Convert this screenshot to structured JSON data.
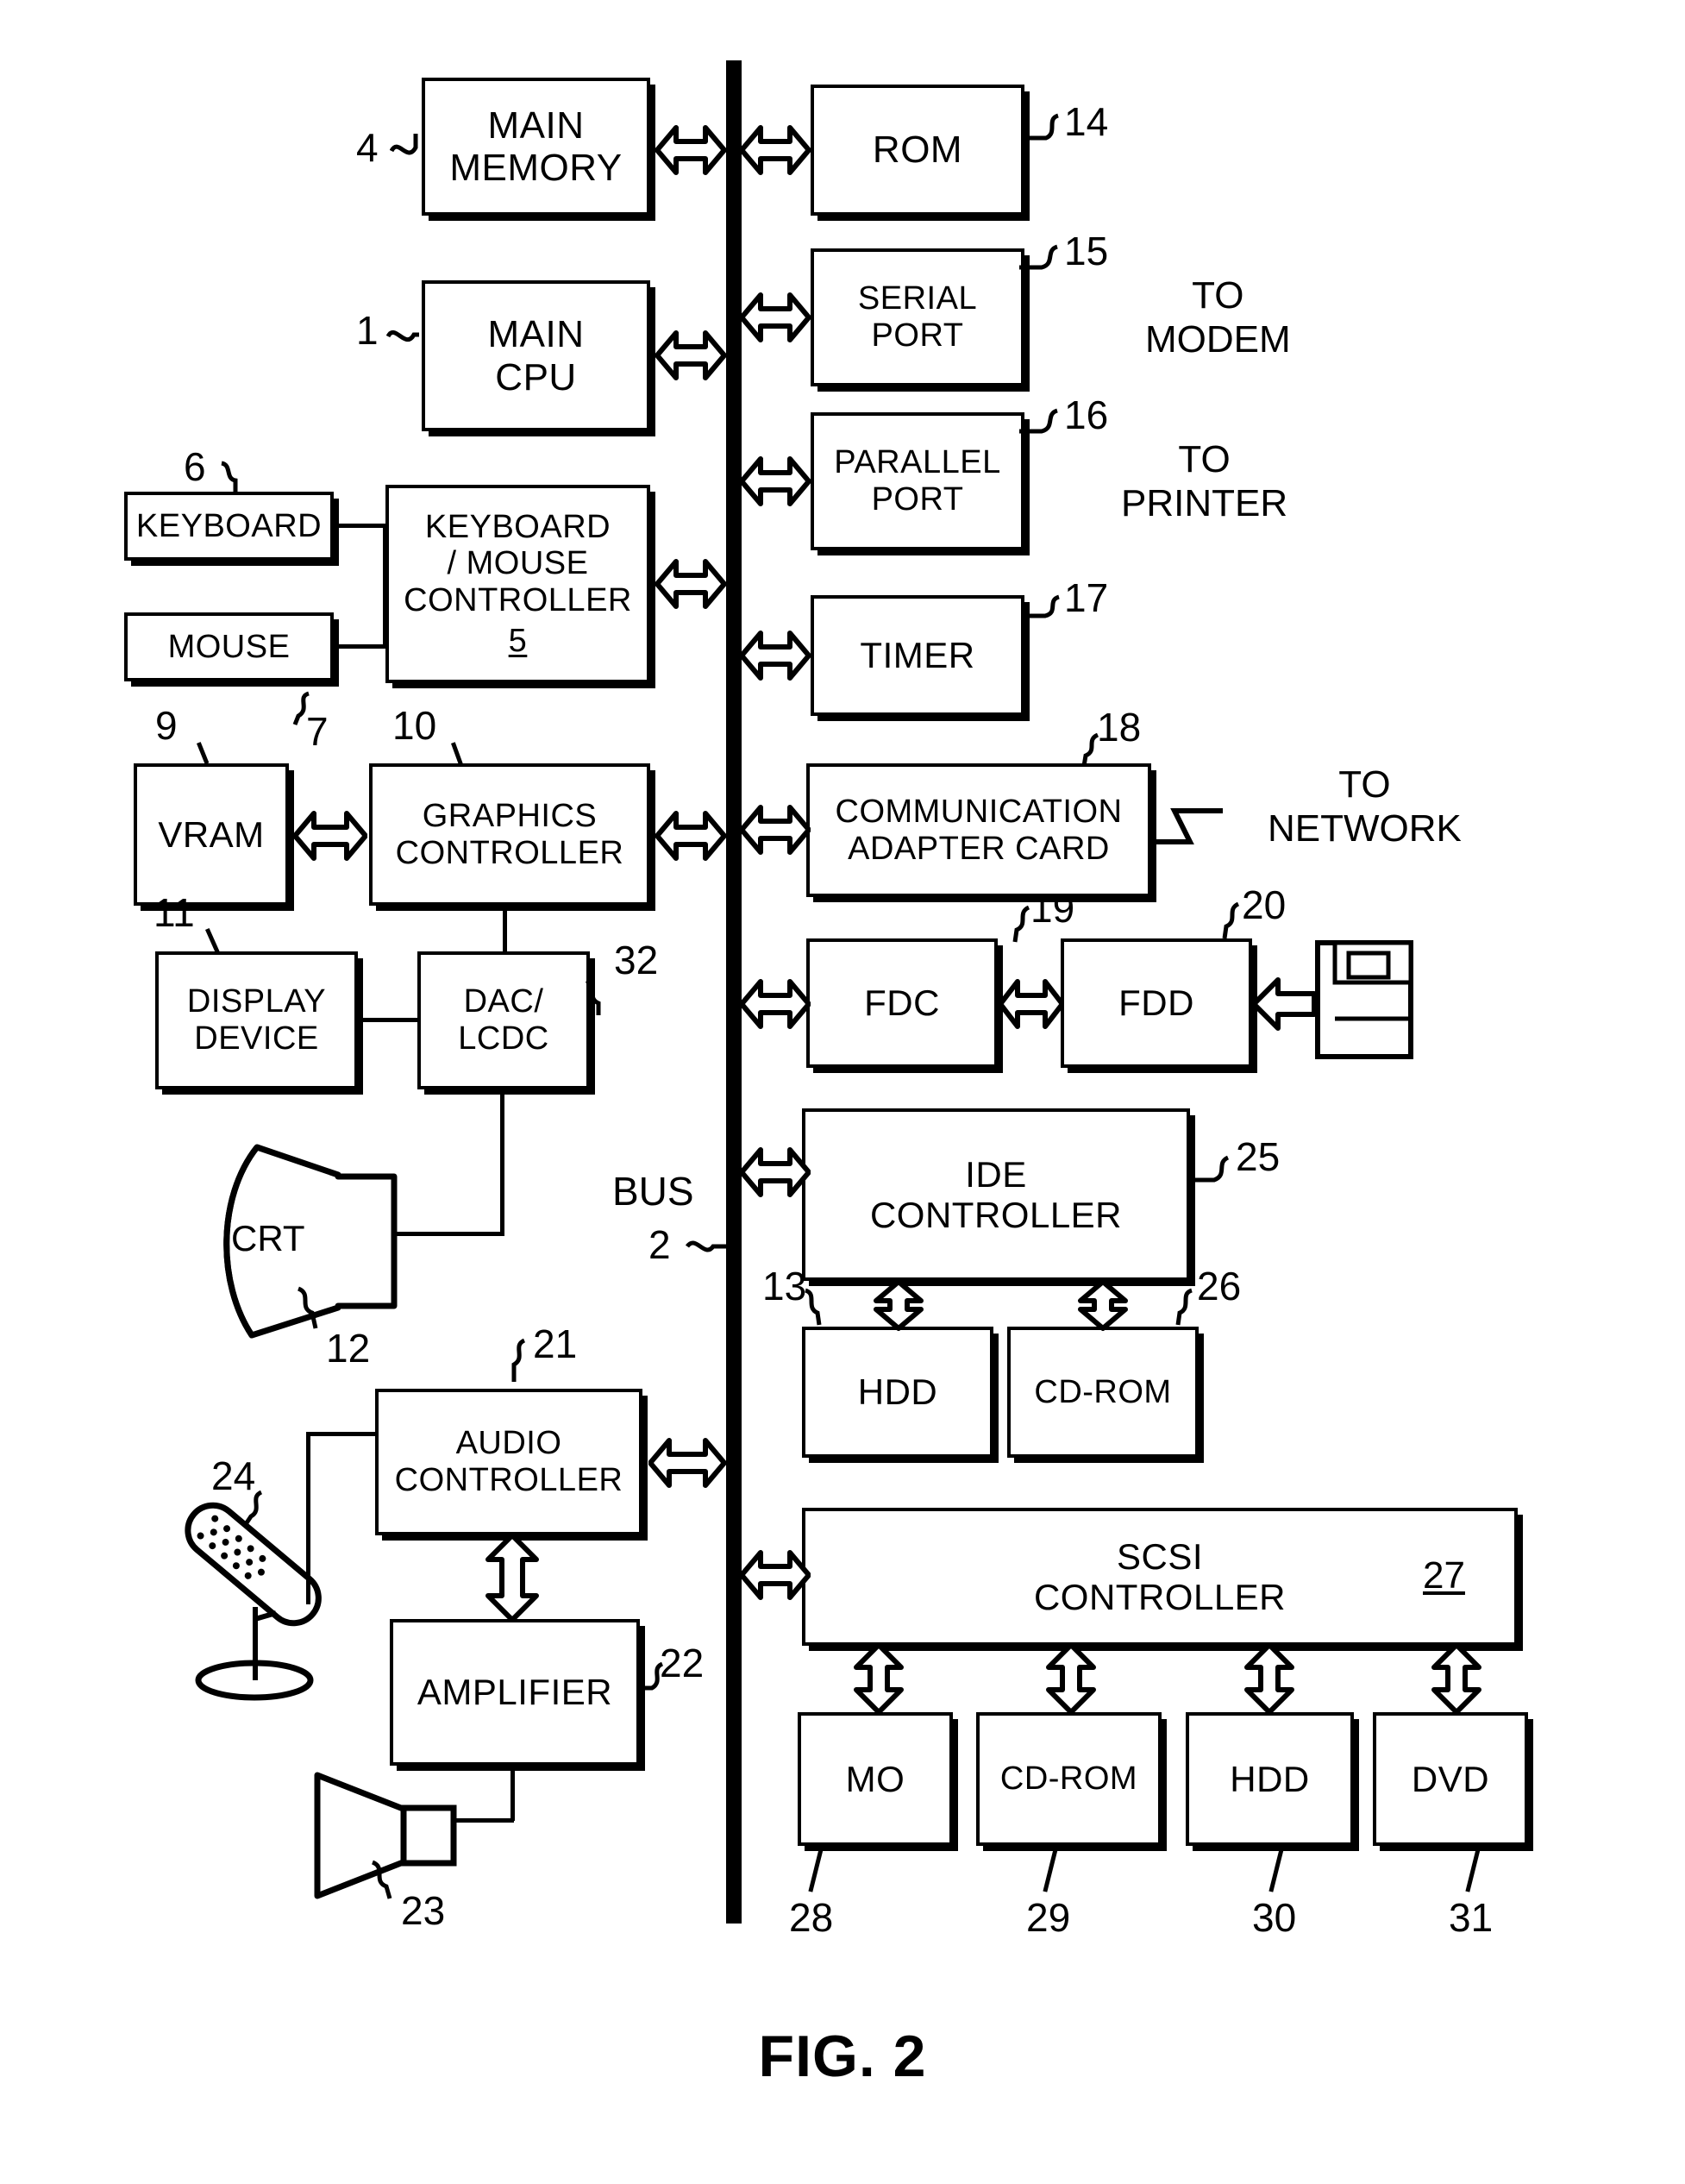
{
  "figure": {
    "caption": "FIG. 2",
    "bus_label": "BUS",
    "bus_ref": "2"
  },
  "blocks": [
    {
      "id": "main-memory",
      "label": "MAIN\nMEMORY",
      "ref": "4"
    },
    {
      "id": "main-cpu",
      "label": "MAIN\nCPU",
      "ref": "1"
    },
    {
      "id": "keyboard",
      "label": "KEYBOARD",
      "ref": "6"
    },
    {
      "id": "mouse",
      "label": "MOUSE",
      "ref": "7"
    },
    {
      "id": "keyboard-mouse-controller",
      "label": "KEYBOARD\n/ MOUSE\nCONTROLLER",
      "ref": "5"
    },
    {
      "id": "vram",
      "label": "VRAM",
      "ref": "9"
    },
    {
      "id": "graphics-controller",
      "label": "GRAPHICS\nCONTROLLER",
      "ref": "10"
    },
    {
      "id": "display-device",
      "label": "DISPLAY\nDEVICE",
      "ref": "11"
    },
    {
      "id": "dac-lcdc",
      "label": "DAC/\nLCDC",
      "ref": "32"
    },
    {
      "id": "crt",
      "label": "CRT",
      "ref": "12"
    },
    {
      "id": "audio-controller",
      "label": "AUDIO\nCONTROLLER",
      "ref": "21"
    },
    {
      "id": "amplifier",
      "label": "AMPLIFIER",
      "ref": "22"
    },
    {
      "id": "speaker",
      "label": "",
      "ref": "23"
    },
    {
      "id": "microphone",
      "label": "",
      "ref": "24"
    },
    {
      "id": "rom",
      "label": "ROM",
      "ref": "14"
    },
    {
      "id": "serial-port",
      "label": "SERIAL\nPORT",
      "ref": "15"
    },
    {
      "id": "parallel-port",
      "label": "PARALLEL\nPORT",
      "ref": "16"
    },
    {
      "id": "timer",
      "label": "TIMER",
      "ref": "17"
    },
    {
      "id": "communication-adapter-card",
      "label": "COMMUNICATION\nADAPTER CARD",
      "ref": "18"
    },
    {
      "id": "fdc",
      "label": "FDC",
      "ref": "19"
    },
    {
      "id": "fdd",
      "label": "FDD",
      "ref": "20"
    },
    {
      "id": "ide-controller",
      "label": "IDE\nCONTROLLER",
      "ref": "25"
    },
    {
      "id": "hdd-ide",
      "label": "HDD",
      "ref": "13"
    },
    {
      "id": "cdrom-ide",
      "label": "CD-ROM",
      "ref": "26"
    },
    {
      "id": "scsi-controller",
      "label": "SCSI\nCONTROLLER",
      "ref": "27"
    },
    {
      "id": "mo",
      "label": "MO",
      "ref": "28"
    },
    {
      "id": "cdrom-scsi",
      "label": "CD-ROM",
      "ref": "29"
    },
    {
      "id": "hdd-scsi",
      "label": "HDD",
      "ref": "30"
    },
    {
      "id": "dvd",
      "label": "DVD",
      "ref": "31"
    }
  ],
  "labels": {
    "main_memory": "MAIN\nMEMORY",
    "main_cpu": "MAIN\nCPU",
    "keyboard": "KEYBOARD",
    "mouse": "MOUSE",
    "keyboard_mouse_controller": "KEYBOARD\n/ MOUSE\nCONTROLLER",
    "keyboard_mouse_controller_ref": "5",
    "vram": "VRAM",
    "graphics_controller": "GRAPHICS\nCONTROLLER",
    "display_device": "DISPLAY\nDEVICE",
    "dac_lcdc": "DAC/\nLCDC",
    "crt": "CRT",
    "audio_controller": "AUDIO\nCONTROLLER",
    "amplifier": "AMPLIFIER",
    "rom": "ROM",
    "serial_port": "SERIAL\nPORT",
    "parallel_port": "PARALLEL\nPORT",
    "timer": "TIMER",
    "communication_adapter_card": "COMMUNICATION\nADAPTER CARD",
    "fdc": "FDC",
    "fdd": "FDD",
    "ide_controller": "IDE\nCONTROLLER",
    "hdd_ide": "HDD",
    "cdrom_ide": "CD-ROM",
    "scsi_controller": "SCSI\nCONTROLLER",
    "scsi_controller_ref": "27",
    "mo": "MO",
    "cdrom_scsi": "CD-ROM",
    "hdd_scsi": "HDD",
    "dvd": "DVD"
  },
  "external": {
    "to_modem": "TO\nMODEM",
    "to_printer": "TO\nPRINTER",
    "to_network": "TO\nNETWORK"
  },
  "refs": {
    "r1": "1",
    "r2": "2",
    "r4": "4",
    "r5": "5",
    "r6": "6",
    "r7": "7",
    "r9": "9",
    "r10": "10",
    "r11": "11",
    "r12": "12",
    "r13": "13",
    "r14": "14",
    "r15": "15",
    "r16": "16",
    "r17": "17",
    "r18": "18",
    "r19": "19",
    "r20": "20",
    "r21": "21",
    "r22": "22",
    "r23": "23",
    "r24": "24",
    "r25": "25",
    "r26": "26",
    "r27": "27",
    "r28": "28",
    "r29": "29",
    "r30": "30",
    "r31": "31",
    "r32": "32"
  },
  "icons": {
    "crt": "crt-monitor-icon",
    "speaker": "speaker-icon",
    "microphone": "microphone-icon",
    "floppy_disk": "floppy-disk-icon",
    "bus": "bus-bar",
    "arrow": "double-headed-arrow-icon",
    "lightning": "lightning-connector-icon",
    "squiggle": "leader-squiggle"
  },
  "colors": {
    "ink": "#000000",
    "paper": "#ffffff"
  }
}
